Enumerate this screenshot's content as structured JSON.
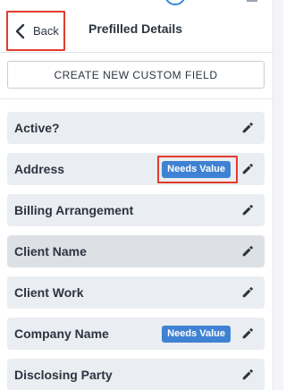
{
  "header": {
    "back_label": "Back",
    "title": "Prefilled Details"
  },
  "actions": {
    "create_label": "CREATE NEW CUSTOM FIELD"
  },
  "fields": [
    {
      "label": "Active?",
      "badge": null,
      "selected": false
    },
    {
      "label": "Address",
      "badge": "Needs Value",
      "selected": false,
      "highlighted": true
    },
    {
      "label": "Billing Arrangement",
      "badge": null,
      "selected": false
    },
    {
      "label": "Client Name",
      "badge": null,
      "selected": true
    },
    {
      "label": "Client Work",
      "badge": null,
      "selected": false
    },
    {
      "label": "Company Name",
      "badge": "Needs Value",
      "selected": false
    },
    {
      "label": "Disclosing Party",
      "badge": null,
      "selected": false
    }
  ],
  "icons": {
    "back": "chevron-left-icon",
    "edit": "pencil-icon"
  },
  "colors": {
    "badge": "#3f82d3",
    "highlight": "#e23b2e",
    "row": "#eaedf1"
  }
}
